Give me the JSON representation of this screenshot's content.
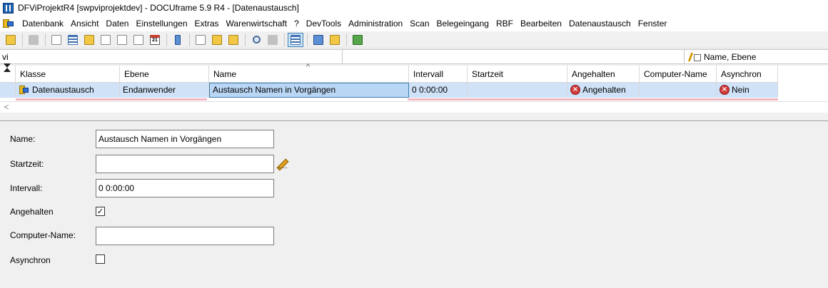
{
  "window": {
    "title": "DFViProjektR4 [swpviprojektdev] - DOCUframe 5.9 R4 - [Datenaustausch]"
  },
  "menu": {
    "items": [
      "Datenbank",
      "Ansicht",
      "Daten",
      "Einstellungen",
      "Extras",
      "Warenwirtschaft",
      "?",
      "DevTools",
      "Administration",
      "Scan",
      "Belegeingang",
      "RBF",
      "Bearbeiten",
      "Datenaustausch",
      "Fenster"
    ]
  },
  "toolbar": {
    "icons": [
      "user-lock-icon",
      "print-icon",
      "contact-card-icon",
      "list-icon",
      "folder-icon",
      "note-icon",
      "tag-icon",
      "layers-icon",
      "calendar-icon",
      "phone-icon",
      "new-document-icon",
      "open-folder-icon",
      "export-icon",
      "search-icon",
      "search-disabled-icon",
      "detail-view-icon",
      "users-icon",
      "users-add-icon",
      "check-icon"
    ],
    "calendar_day": "21"
  },
  "search": {
    "value": "vi",
    "scope": "Name, Ebene"
  },
  "grid": {
    "columns": [
      "Klasse",
      "Ebene",
      "Name",
      "Intervall",
      "Startzeit",
      "Angehalten",
      "Computer-Name",
      "Asynchron"
    ],
    "sort_indicator": "^",
    "rows": [
      {
        "klasse": "Datenaustausch",
        "ebene": "Endanwender",
        "name": "Austausch Namen in Vorgängen",
        "intervall": "0 0:00:00",
        "startzeit": "",
        "angehalten": "Angehalten",
        "computer_name": "",
        "asynchron": "Nein"
      }
    ],
    "scroll_arrow": "<"
  },
  "form": {
    "name_label": "Name:",
    "name_value": "Austausch Namen in Vorgängen",
    "startzeit_label": "Startzeit:",
    "startzeit_value": "",
    "intervall_label": "Intervall:",
    "intervall_value": "0 0:00:00",
    "angehalten_label": "Angehalten",
    "angehalten_checked": true,
    "angehalten_mark": "✓",
    "computer_label": "Computer-Name:",
    "computer_value": "",
    "asynchron_label": "Asynchron",
    "asynchron_checked": false
  },
  "colors": {
    "selection": "#cfe2f7",
    "focus_border": "#3c7fb1",
    "error_red": "#d23a3a",
    "row_underline": "#f2b7c2"
  }
}
